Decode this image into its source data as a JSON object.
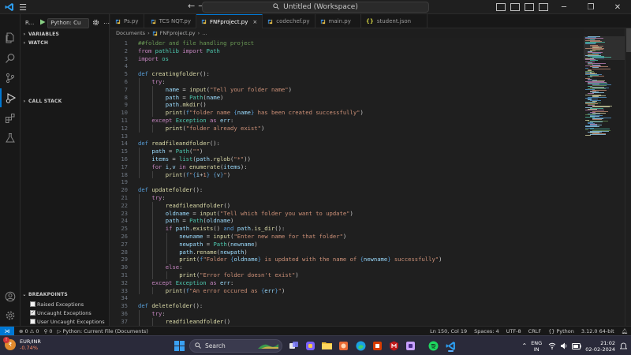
{
  "titlebar": {
    "window_title": "Untitled (Workspace)",
    "colors": {
      "background": "#1f1f1f",
      "accent": "#0078d4"
    }
  },
  "sidebar": {
    "run_label": "R...",
    "run_config": "Python: Cu",
    "sections": {
      "variables": "VARIABLES",
      "watch": "WATCH",
      "call_stack": "CALL STACK",
      "breakpoints": "BREAKPOINTS"
    },
    "breakpoints": [
      {
        "label": "Raised Exceptions",
        "checked": false
      },
      {
        "label": "Uncaught Exceptions",
        "checked": true
      },
      {
        "label": "User Uncaught Exceptions",
        "checked": false
      }
    ]
  },
  "tabs": [
    {
      "label": "Ps.py",
      "icon": "python-icon",
      "active": false
    },
    {
      "label": "TCS NQT.py",
      "icon": "python-icon",
      "active": false
    },
    {
      "label": "FNFproject.py",
      "icon": "python-icon",
      "active": true,
      "close": "×"
    },
    {
      "label": "codechef.py",
      "icon": "python-icon",
      "active": false
    },
    {
      "label": "main.py",
      "icon": "python-icon",
      "active": false
    },
    {
      "label": "student.json",
      "icon": "json-icon",
      "active": false,
      "icon_text": "{}"
    }
  ],
  "breadcrumb": {
    "folder": "Documents",
    "file": "FNFproject.py",
    "symbol": "..."
  },
  "editor": {
    "lines": [
      {
        "n": "1",
        "indent": 0,
        "parts": [
          [
            "c",
            "##folder and file handling project"
          ]
        ]
      },
      {
        "n": "2",
        "indent": 0,
        "parts": [
          [
            "k",
            "from"
          ],
          [
            "",
            " "
          ],
          [
            "cl",
            "pathlib"
          ],
          [
            "",
            " "
          ],
          [
            "k",
            "import"
          ],
          [
            "",
            " "
          ],
          [
            "cl",
            "Path"
          ]
        ]
      },
      {
        "n": "3",
        "indent": 0,
        "parts": [
          [
            "k",
            "import"
          ],
          [
            "",
            " "
          ],
          [
            "cl",
            "os"
          ]
        ]
      },
      {
        "n": "4",
        "indent": 0,
        "parts": []
      },
      {
        "n": "5",
        "indent": 0,
        "parts": [
          [
            "d",
            "def"
          ],
          [
            "",
            " "
          ],
          [
            "f",
            "creatingfolder"
          ],
          [
            "",
            "():"
          ]
        ]
      },
      {
        "n": "6",
        "indent": 1,
        "parts": [
          [
            "k",
            "try"
          ],
          [
            "",
            ":"
          ]
        ]
      },
      {
        "n": "7",
        "indent": 2,
        "parts": [
          [
            "v",
            "name"
          ],
          [
            "",
            " = "
          ],
          [
            "f",
            "input"
          ],
          [
            "",
            "("
          ],
          [
            "s",
            "\"Tell your folder name\""
          ],
          [
            "",
            ")"
          ]
        ]
      },
      {
        "n": "8",
        "indent": 2,
        "parts": [
          [
            "v",
            "path"
          ],
          [
            "",
            " = "
          ],
          [
            "cl",
            "Path"
          ],
          [
            "",
            "("
          ],
          [
            "v",
            "name"
          ],
          [
            "",
            ")"
          ]
        ]
      },
      {
        "n": "9",
        "indent": 2,
        "parts": [
          [
            "v",
            "path"
          ],
          [
            "",
            "."
          ],
          [
            "f",
            "mkdir"
          ],
          [
            "",
            "()"
          ]
        ]
      },
      {
        "n": "10",
        "indent": 2,
        "parts": [
          [
            "f",
            "print"
          ],
          [
            "",
            "("
          ],
          [
            "d",
            "f"
          ],
          [
            "s",
            "\"folder name "
          ],
          [
            "d",
            "{"
          ],
          [
            "v",
            "name"
          ],
          [
            "d",
            "}"
          ],
          [
            "s",
            " has been created successfully\""
          ],
          [
            "",
            ")"
          ]
        ]
      },
      {
        "n": "11",
        "indent": 1,
        "parts": [
          [
            "k",
            "except"
          ],
          [
            "",
            " "
          ],
          [
            "cl",
            "Exception"
          ],
          [
            "",
            " "
          ],
          [
            "k",
            "as"
          ],
          [
            "",
            " "
          ],
          [
            "v",
            "err"
          ],
          [
            "",
            ":"
          ]
        ]
      },
      {
        "n": "12",
        "indent": 2,
        "parts": [
          [
            "f",
            "print"
          ],
          [
            "",
            "("
          ],
          [
            "s",
            "\"folder already exist\""
          ],
          [
            "",
            ")"
          ]
        ]
      },
      {
        "n": "13",
        "indent": 0,
        "parts": []
      },
      {
        "n": "14",
        "indent": 0,
        "parts": [
          [
            "d",
            "def"
          ],
          [
            "",
            " "
          ],
          [
            "f",
            "readfileandfolder"
          ],
          [
            "",
            "():"
          ]
        ]
      },
      {
        "n": "15",
        "indent": 1,
        "parts": [
          [
            "v",
            "path"
          ],
          [
            "",
            " = "
          ],
          [
            "cl",
            "Path"
          ],
          [
            "",
            "("
          ],
          [
            "s",
            "\"\""
          ],
          [
            "",
            ")"
          ]
        ]
      },
      {
        "n": "16",
        "indent": 1,
        "parts": [
          [
            "v",
            "items"
          ],
          [
            "",
            " = "
          ],
          [
            "cl",
            "list"
          ],
          [
            "",
            "("
          ],
          [
            "v",
            "path"
          ],
          [
            "",
            "."
          ],
          [
            "f",
            "rglob"
          ],
          [
            "",
            "("
          ],
          [
            "s",
            "\"*\""
          ],
          [
            "",
            "))"
          ]
        ]
      },
      {
        "n": "17",
        "indent": 1,
        "parts": [
          [
            "k",
            "for"
          ],
          [
            "",
            " "
          ],
          [
            "v",
            "i"
          ],
          [
            "",
            ","
          ],
          [
            "v",
            "v"
          ],
          [
            "",
            " "
          ],
          [
            "k",
            "in"
          ],
          [
            "",
            " "
          ],
          [
            "f",
            "enumerate"
          ],
          [
            "",
            "("
          ],
          [
            "v",
            "items"
          ],
          [
            "",
            "):"
          ]
        ]
      },
      {
        "n": "18",
        "indent": 2,
        "parts": [
          [
            "f",
            "print"
          ],
          [
            "",
            "("
          ],
          [
            "d",
            "f"
          ],
          [
            "s",
            "\""
          ],
          [
            "d",
            "{"
          ],
          [
            "v",
            "i"
          ],
          [
            "",
            "+"
          ],
          [
            "s",
            "1"
          ],
          [
            "d",
            "}"
          ],
          [
            "s",
            " "
          ],
          [
            "d",
            "{"
          ],
          [
            "v",
            "v"
          ],
          [
            "d",
            "}"
          ],
          [
            "s",
            "\""
          ],
          [
            "",
            ")"
          ]
        ]
      },
      {
        "n": "19",
        "indent": 0,
        "parts": []
      },
      {
        "n": "20",
        "indent": 0,
        "parts": [
          [
            "d",
            "def"
          ],
          [
            "",
            " "
          ],
          [
            "f",
            "updatefolder"
          ],
          [
            "",
            "():"
          ]
        ]
      },
      {
        "n": "21",
        "indent": 1,
        "parts": [
          [
            "k",
            "try"
          ],
          [
            "",
            ":"
          ]
        ]
      },
      {
        "n": "22",
        "indent": 2,
        "parts": [
          [
            "f",
            "readfileandfolder"
          ],
          [
            "",
            "()"
          ]
        ]
      },
      {
        "n": "23",
        "indent": 2,
        "parts": [
          [
            "v",
            "oldname"
          ],
          [
            "",
            " = "
          ],
          [
            "f",
            "input"
          ],
          [
            "",
            "("
          ],
          [
            "s",
            "\"Tell which folder you want to update\""
          ],
          [
            "",
            ")"
          ]
        ]
      },
      {
        "n": "24",
        "indent": 2,
        "parts": [
          [
            "v",
            "path"
          ],
          [
            "",
            " = "
          ],
          [
            "cl",
            "Path"
          ],
          [
            "",
            "("
          ],
          [
            "v",
            "oldname"
          ],
          [
            "",
            ")"
          ]
        ]
      },
      {
        "n": "25",
        "indent": 2,
        "parts": [
          [
            "k",
            "if"
          ],
          [
            "",
            " "
          ],
          [
            "v",
            "path"
          ],
          [
            "",
            "."
          ],
          [
            "f",
            "exists"
          ],
          [
            "",
            "() "
          ],
          [
            "d",
            "and"
          ],
          [
            "",
            " "
          ],
          [
            "v",
            "path"
          ],
          [
            "",
            "."
          ],
          [
            "f",
            "is_dir"
          ],
          [
            "",
            "():"
          ]
        ]
      },
      {
        "n": "26",
        "indent": 3,
        "parts": [
          [
            "v",
            "newname"
          ],
          [
            "",
            " = "
          ],
          [
            "f",
            "input"
          ],
          [
            "",
            "("
          ],
          [
            "s",
            "\"Enter new name for that folder\""
          ],
          [
            "",
            ")"
          ]
        ]
      },
      {
        "n": "27",
        "indent": 3,
        "parts": [
          [
            "v",
            "newpath"
          ],
          [
            "",
            " = "
          ],
          [
            "cl",
            "Path"
          ],
          [
            "",
            "("
          ],
          [
            "v",
            "newname"
          ],
          [
            "",
            ")"
          ]
        ]
      },
      {
        "n": "28",
        "indent": 3,
        "parts": [
          [
            "v",
            "path"
          ],
          [
            "",
            "."
          ],
          [
            "f",
            "rename"
          ],
          [
            "",
            "("
          ],
          [
            "v",
            "newpath"
          ],
          [
            "",
            ")"
          ]
        ]
      },
      {
        "n": "29",
        "indent": 3,
        "parts": [
          [
            "f",
            "print"
          ],
          [
            "",
            "("
          ],
          [
            "d",
            "f"
          ],
          [
            "s",
            "\"Folder "
          ],
          [
            "d",
            "{"
          ],
          [
            "v",
            "oldname"
          ],
          [
            "d",
            "}"
          ],
          [
            "s",
            " is updated with the name of "
          ],
          [
            "d",
            "{"
          ],
          [
            "v",
            "newname"
          ],
          [
            "d",
            "}"
          ],
          [
            "s",
            " successfully\""
          ],
          [
            "",
            ")"
          ]
        ]
      },
      {
        "n": "30",
        "indent": 2,
        "parts": [
          [
            "k",
            "else"
          ],
          [
            "",
            ":"
          ]
        ]
      },
      {
        "n": "31",
        "indent": 3,
        "parts": [
          [
            "f",
            "print"
          ],
          [
            "",
            "("
          ],
          [
            "s",
            "\"Error folder doesn't exist\""
          ],
          [
            "",
            ")"
          ]
        ]
      },
      {
        "n": "32",
        "indent": 1,
        "parts": [
          [
            "k",
            "except"
          ],
          [
            "",
            " "
          ],
          [
            "cl",
            "Exception"
          ],
          [
            "",
            " "
          ],
          [
            "k",
            "as"
          ],
          [
            "",
            " "
          ],
          [
            "v",
            "err"
          ],
          [
            "",
            ":"
          ]
        ]
      },
      {
        "n": "33",
        "indent": 2,
        "parts": [
          [
            "f",
            "print"
          ],
          [
            "",
            "("
          ],
          [
            "d",
            "f"
          ],
          [
            "s",
            "\"An error occured as "
          ],
          [
            "d",
            "{"
          ],
          [
            "v",
            "err"
          ],
          [
            "d",
            "}"
          ],
          [
            "s",
            "\""
          ],
          [
            "",
            ")"
          ]
        ]
      },
      {
        "n": "34",
        "indent": 0,
        "parts": []
      },
      {
        "n": "35",
        "indent": 0,
        "parts": [
          [
            "d",
            "def"
          ],
          [
            "",
            " "
          ],
          [
            "f",
            "deletefolder"
          ],
          [
            "",
            "():"
          ]
        ]
      },
      {
        "n": "36",
        "indent": 1,
        "parts": [
          [
            "k",
            "try"
          ],
          [
            "",
            ":"
          ]
        ]
      },
      {
        "n": "37",
        "indent": 2,
        "parts": [
          [
            "f",
            "readfileandfolder"
          ],
          [
            "",
            "()"
          ]
        ]
      }
    ],
    "colors": {
      "keyword": "#c586c0",
      "def": "#569cd6",
      "function": "#dcdcaa",
      "string": "#ce9178",
      "comment": "#6a9955",
      "class": "#4ec9b0",
      "variable": "#9cdcfe"
    }
  },
  "statusbar": {
    "errors": "0",
    "warnings": "0",
    "ports": "0",
    "debug_config": "Python: Current File (Documents)",
    "position": "Ln 150, Col 19",
    "spaces": "Spaces: 4",
    "encoding": "UTF-8",
    "eol": "CRLF",
    "language": "Python",
    "interpreter": "3.12.0 64-bit"
  },
  "taskbar": {
    "ticker_name": "EUR/INR",
    "ticker_change": "-0.74%",
    "search_placeholder": "Search",
    "lang_line1": "ENG",
    "lang_line2": "IN",
    "time": "21:02",
    "date": "02-02-2024"
  }
}
